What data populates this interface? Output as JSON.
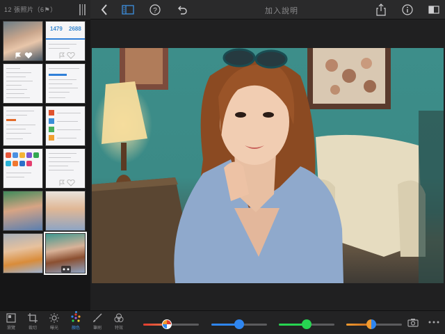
{
  "window": {
    "photo_count": "12 張照片（6⚑）",
    "title": "加入說明"
  },
  "toolbar_top": {
    "icons": [
      "back-chevron-icon",
      "sidebar-toggle-icon",
      "help-icon",
      "undo-icon",
      "share-icon",
      "info-icon",
      "compare-icon"
    ]
  },
  "thumbnails": {
    "stats": {
      "left": "1479",
      "right": "2688"
    }
  },
  "tools": [
    {
      "label": "瀏覽",
      "icon": "browse-icon"
    },
    {
      "label": "裁切",
      "icon": "crop-icon"
    },
    {
      "label": "曝光",
      "icon": "exposure-icon"
    },
    {
      "label": "顏色",
      "icon": "color-icon"
    },
    {
      "label": "筆刷",
      "icon": "brush-icon"
    },
    {
      "label": "特效",
      "icon": "effects-icon"
    }
  ],
  "active_tool": "顏色",
  "sliders": [
    {
      "name": "saturation",
      "knob_color": "#e33b2e",
      "level": 0.45
    },
    {
      "name": "blues",
      "knob_color": "#2f86f0",
      "level": 0.55
    },
    {
      "name": "greens",
      "knob_color": "#27d451",
      "level": 0.55
    },
    {
      "name": "skin-tones",
      "knob_color": "#f19a2e",
      "level": 0.5
    }
  ],
  "colors": {
    "accent": "#3d8fe0",
    "background": "#1b1b1c"
  }
}
